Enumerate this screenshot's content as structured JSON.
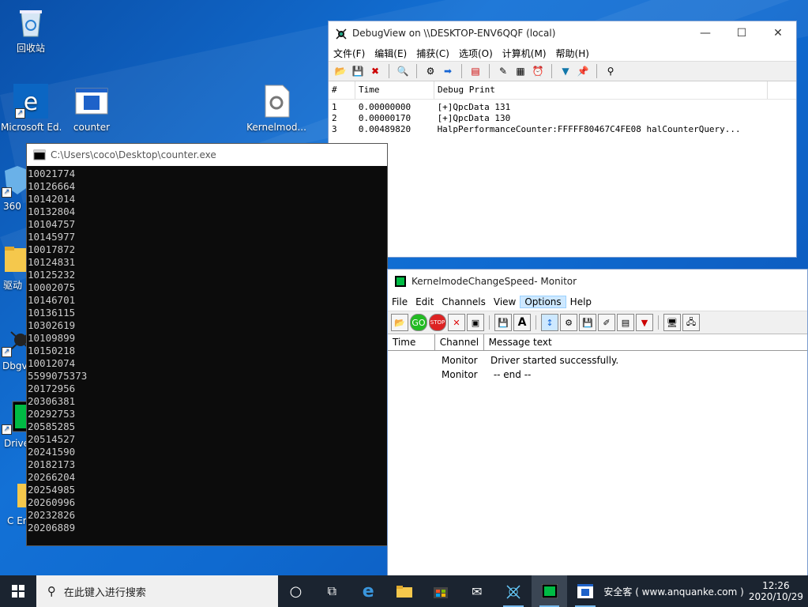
{
  "desktop": {
    "icons": [
      {
        "label": "回收站"
      },
      {
        "label": "Microsoft Ed..."
      },
      {
        "label": "counter"
      },
      {
        "label": "Kernelmod..."
      },
      {
        "label": "360"
      },
      {
        "label": "驱动"
      },
      {
        "label": "Dbgv"
      },
      {
        "label": "Drive"
      },
      {
        "label": "C Engi"
      }
    ]
  },
  "debugview": {
    "title": "DebugView on \\\\DESKTOP-ENV6QQF (local)",
    "menu": [
      "文件(F)",
      "编辑(E)",
      "捕获(C)",
      "选项(O)",
      "计算机(M)",
      "帮助(H)"
    ],
    "columns": [
      "#",
      "Time",
      "Debug Print"
    ],
    "rows": [
      {
        "n": "1",
        "time": "0.00000000",
        "msg": "[+]QpcData 131"
      },
      {
        "n": "2",
        "time": "0.00000170",
        "msg": "[+]QpcData 130"
      },
      {
        "n": "3",
        "time": "0.00489820",
        "msg": "HalpPerformanceCounter:FFFFF80467C4FE08  halCounterQuery..."
      }
    ]
  },
  "console": {
    "title": "C:\\Users\\coco\\Desktop\\counter.exe",
    "lines": [
      "10021774",
      "10126664",
      "10142014",
      "10132804",
      "10104757",
      "10145977",
      "10017872",
      "10124831",
      "10125232",
      "10002075",
      "10146701",
      "10136115",
      "10302619",
      "10109899",
      "10150218",
      "10012074",
      "5599075373",
      "20172956",
      "20306381",
      "20292753",
      "20585285",
      "20514527",
      "20241590",
      "20182173",
      "20266204",
      "20254985",
      "20260996",
      "20232826",
      "20206889"
    ]
  },
  "monitor": {
    "title": "KernelmodeChangeSpeed- Monitor",
    "menu": [
      "File",
      "Edit",
      "Channels",
      "View",
      "Options",
      "Help"
    ],
    "active_menu": "Options",
    "columns": [
      "Time",
      "Channel",
      "Message text"
    ],
    "rows": [
      {
        "time": "",
        "channel": "Monitor",
        "msg": "Driver started successfully."
      },
      {
        "time": "",
        "channel": "Monitor",
        "msg": " -- end --"
      }
    ]
  },
  "taskbar": {
    "search_placeholder": "在此键入进行搜索",
    "tray_text": "安全客 ( www.anquanke.com )",
    "time": "12:26",
    "date": "2020/10/29"
  },
  "colors": {
    "accent": "#0078d7",
    "console_bg": "#0c0c0c",
    "taskbar_bg": "#1b2430"
  }
}
